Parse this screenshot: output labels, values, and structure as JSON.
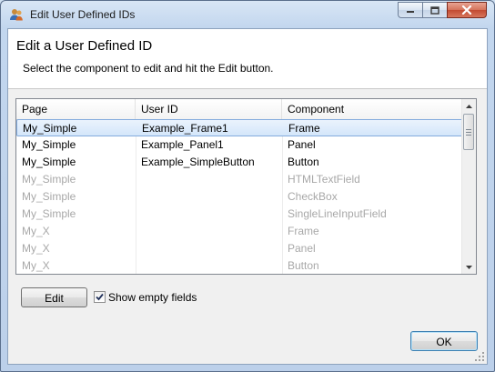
{
  "window": {
    "title": "Edit User Defined IDs",
    "icon": "people-icon"
  },
  "titlebar_buttons": {
    "minimize": "minimize-icon",
    "maximize": "maximize-icon",
    "close": "close-icon"
  },
  "header": {
    "title": "Edit a User Defined ID",
    "description": "Select the component to edit and hit the Edit button."
  },
  "table": {
    "columns": [
      "Page",
      "User ID",
      "Component"
    ],
    "rows": [
      {
        "page": "My_Simple",
        "user_id": "Example_Frame1",
        "component": "Frame",
        "state": "selected"
      },
      {
        "page": "My_Simple",
        "user_id": "Example_Panel1",
        "component": "Panel",
        "state": "normal"
      },
      {
        "page": "My_Simple",
        "user_id": "Example_SimpleButton",
        "component": "Button",
        "state": "normal"
      },
      {
        "page": "My_Simple",
        "user_id": "",
        "component": "HTMLTextField",
        "state": "dim"
      },
      {
        "page": "My_Simple",
        "user_id": "",
        "component": "CheckBox",
        "state": "dim"
      },
      {
        "page": "My_Simple",
        "user_id": "",
        "component": "SingleLineInputField",
        "state": "dim"
      },
      {
        "page": "My_X",
        "user_id": "",
        "component": "Frame",
        "state": "dim"
      },
      {
        "page": "My_X",
        "user_id": "",
        "component": "Panel",
        "state": "dim"
      },
      {
        "page": "My_X",
        "user_id": "",
        "component": "Button",
        "state": "dim"
      }
    ]
  },
  "actions": {
    "edit_label": "Edit",
    "show_empty_label": "Show empty fields",
    "show_empty_checked": true,
    "ok_label": "OK"
  },
  "colors": {
    "selection": "#d4e6fa",
    "dim_text": "#a8a8a8"
  }
}
